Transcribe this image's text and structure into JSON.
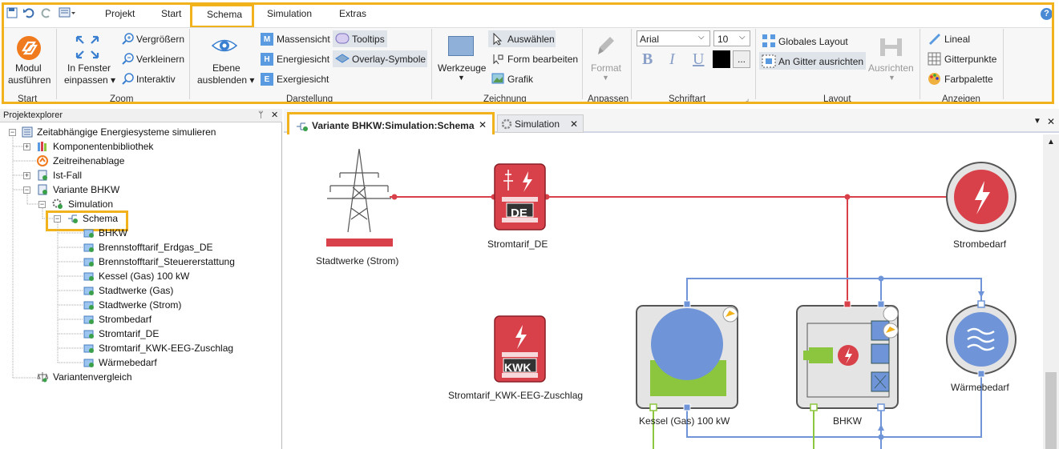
{
  "ribbon": {
    "tabs": [
      "Projekt",
      "Start",
      "Schema",
      "Simulation",
      "Extras"
    ],
    "active_tab": "Schema",
    "groups": {
      "start": {
        "label": "Start",
        "run_button": "Modul ausführen",
        "run_line1": "Modul",
        "run_line2": "ausführen"
      },
      "zoom": {
        "label": "Zoom",
        "fit_line1": "In Fenster",
        "fit_line2": "einpassen ▾",
        "zoom_in": "Vergrößern",
        "zoom_out": "Verkleinern",
        "interactive": "Interaktiv"
      },
      "darstellung": {
        "label": "Darstellung",
        "layer_line1": "Ebene",
        "layer_line2": "ausblenden ▾",
        "mass_view": "Massensicht",
        "energy_view": "Energiesicht",
        "exergy_view": "Exergiesicht",
        "tooltips": "Tooltips",
        "overlay": "Overlay-Symbole"
      },
      "zeichnung": {
        "label": "Zeichnung",
        "tools": "Werkzeuge",
        "select": "Auswählen",
        "edit_shape": "Form bearbeiten",
        "graphic": "Grafik"
      },
      "anpassen": {
        "label": "Anpassen",
        "format": "Format"
      },
      "schriftart": {
        "label": "Schriftart",
        "font": "Arial",
        "size": "10",
        "bold": "B",
        "italic": "I",
        "underline": "U",
        "more": "..."
      },
      "layout": {
        "label": "Layout",
        "global_layout": "Globales Layout",
        "snap_grid": "An Gitter ausrichten",
        "align": "Ausrichten"
      },
      "anzeigen": {
        "label": "Anzeigen",
        "ruler": "Lineal",
        "grid_points": "Gitterpunkte",
        "palette": "Farbpalette"
      }
    }
  },
  "explorer": {
    "title": "Projektexplorer",
    "pin": "ᛘ",
    "close": "✕",
    "items": [
      {
        "label": "Zeitabhängige Energiesysteme simulieren"
      },
      {
        "label": "Komponentenbibliothek"
      },
      {
        "label": "Zeitreihenablage"
      },
      {
        "label": "Ist-Fall"
      },
      {
        "label": "Variante BHKW"
      },
      {
        "label": "Simulation"
      },
      {
        "label": "Schema"
      },
      {
        "label": "BHKW"
      },
      {
        "label": "Brennstofftarif_Erdgas_DE"
      },
      {
        "label": "Brennstofftarif_Steuererstattung"
      },
      {
        "label": "Kessel (Gas) 100 kW"
      },
      {
        "label": "Stadtwerke (Gas)"
      },
      {
        "label": "Stadtwerke (Strom)"
      },
      {
        "label": "Strombedarf"
      },
      {
        "label": "Stromtarif_DE"
      },
      {
        "label": "Stromtarif_KWK-EEG-Zuschlag"
      },
      {
        "label": "Wärmebedarf"
      },
      {
        "label": "Variantenvergleich"
      }
    ]
  },
  "doc_tabs": [
    {
      "label": "Variante BHKW:Simulation:Schema",
      "close": "✕"
    },
    {
      "label": "Simulation",
      "close": "✕"
    }
  ],
  "schema": {
    "nodes": {
      "stadtwerke_strom": "Stadtwerke (Strom)",
      "stromtarif_de": "Stromtarif_DE",
      "stromtarif_de_badge": "DE",
      "strombedarf": "Strombedarf",
      "stromtarif_kwk": "Stromtarif_KWK-EEG-Zuschlag",
      "stromtarif_kwk_badge": "KWK",
      "kessel": "Kessel (Gas) 100 kW",
      "bhkw": "BHKW",
      "waermebedarf": "Wärmebedarf"
    }
  },
  "colors": {
    "accent": "#f2b21c",
    "electric": "#d9414a",
    "heat": "#6f95d8",
    "gas": "#8cc63f"
  }
}
